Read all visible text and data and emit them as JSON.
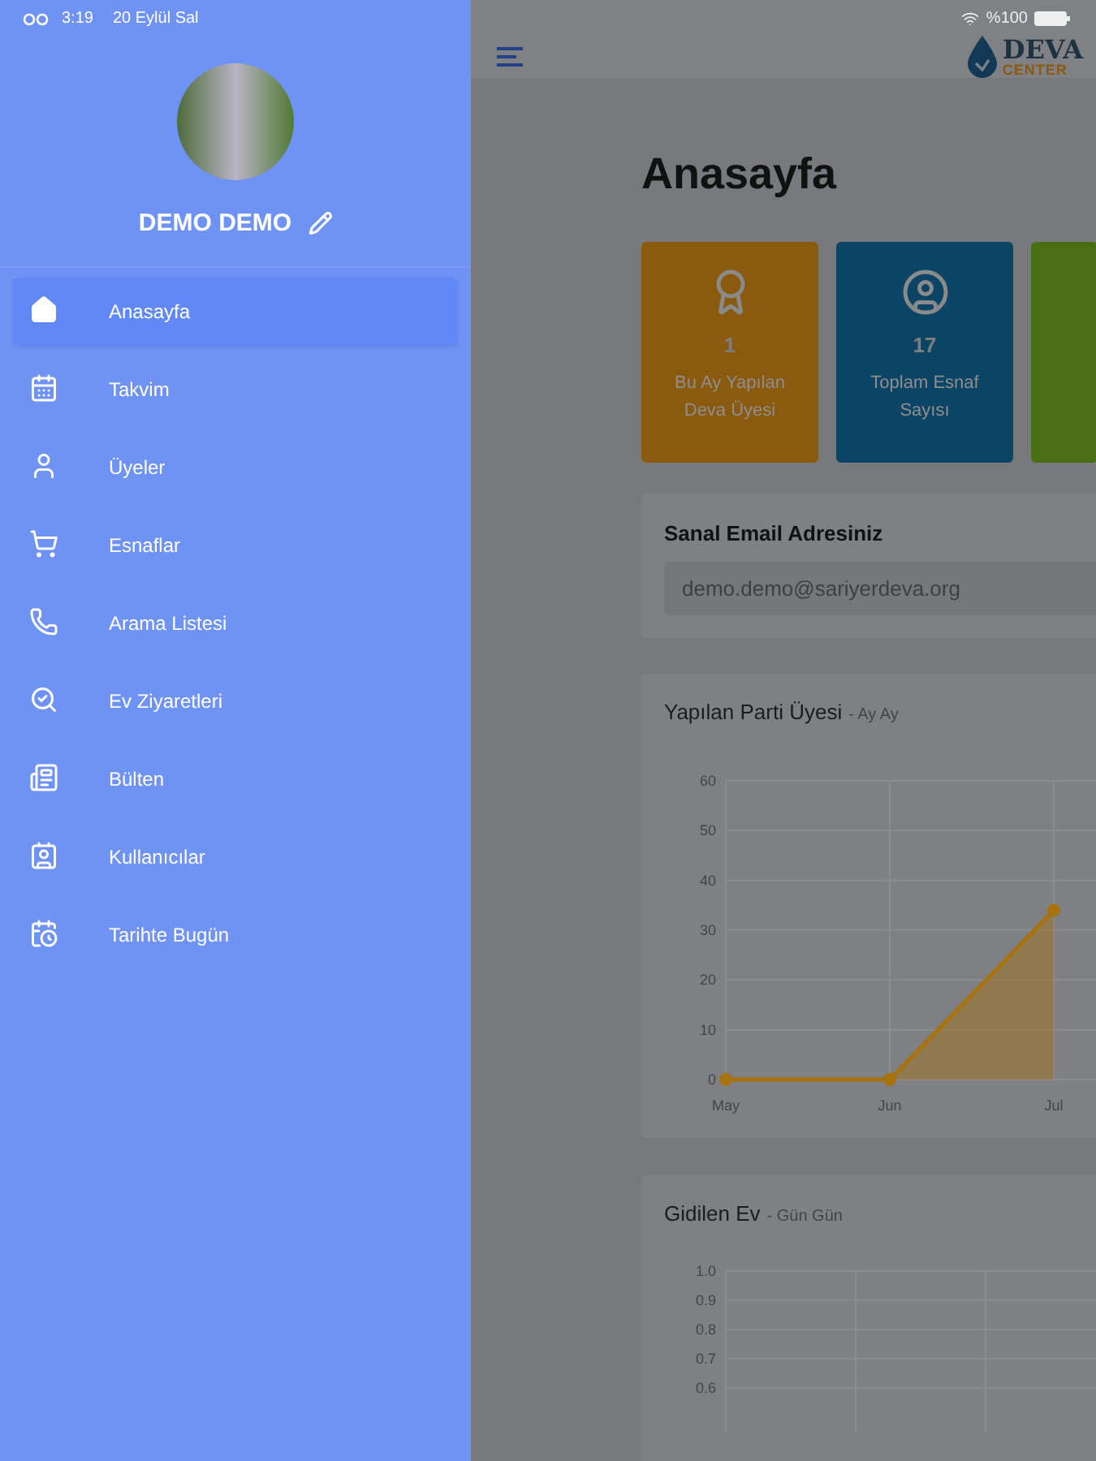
{
  "status_bar": {
    "time": "3:19",
    "date": "20 Eylül Sal",
    "battery": "%100"
  },
  "drawer": {
    "user_name": "DEMO DEMO",
    "items": [
      {
        "label": "Anasayfa",
        "kind": "home",
        "selected": true
      },
      {
        "label": "Takvim",
        "kind": "calendar",
        "selected": false
      },
      {
        "label": "Üyeler",
        "kind": "person",
        "selected": false
      },
      {
        "label": "Esnaflar",
        "kind": "cart",
        "selected": false
      },
      {
        "label": "Arama Listesi",
        "kind": "phone",
        "selected": false
      },
      {
        "label": "Ev Ziyaretleri",
        "kind": "house",
        "selected": false
      },
      {
        "label": "Bülten",
        "kind": "newsletter",
        "selected": false
      },
      {
        "label": "Kullanıcılar",
        "kind": "idcard",
        "selected": false
      },
      {
        "label": "Tarihte Bugün",
        "kind": "history",
        "selected": false
      }
    ]
  },
  "header": {
    "logo_top": "DEVA",
    "logo_bottom": "CENTER"
  },
  "page_title": "Anasayfa",
  "stat_cards": [
    {
      "kind": "medal",
      "value": "1",
      "label_lines": [
        "Bu Ay Yapılan",
        "Deva Üyesi"
      ],
      "color": "#8a5a0e"
    },
    {
      "kind": "user",
      "value": "17",
      "label_lines": [
        "Toplam Esnaf",
        "Sayısı"
      ],
      "color": "#0c4466"
    },
    {
      "kind": "cut",
      "color": "#4a6e14"
    }
  ],
  "email_card": {
    "title": "Sanal Email Adresiniz",
    "value": "demo.demo@sariyerdeva.org"
  },
  "charts": [
    {
      "title": "Yapılan Parti Üyesi",
      "subtitle": "- Ay Ay",
      "chart_data": {
        "type": "area",
        "categories": [
          "May",
          "Jun",
          "Jul"
        ],
        "series": [
          {
            "color": "#a8720f",
            "values": [
              0,
              0,
              34
            ]
          }
        ],
        "ylim": [
          0,
          60
        ],
        "yticks": [
          0,
          10,
          20,
          30,
          40,
          50,
          60
        ],
        "grid": true
      }
    },
    {
      "title": "Gidilen Ev",
      "subtitle": "- Gün Gün",
      "axis_labels": [
        "1.0",
        "0.9",
        "0.8",
        "0.7",
        "0.6"
      ]
    }
  ]
}
